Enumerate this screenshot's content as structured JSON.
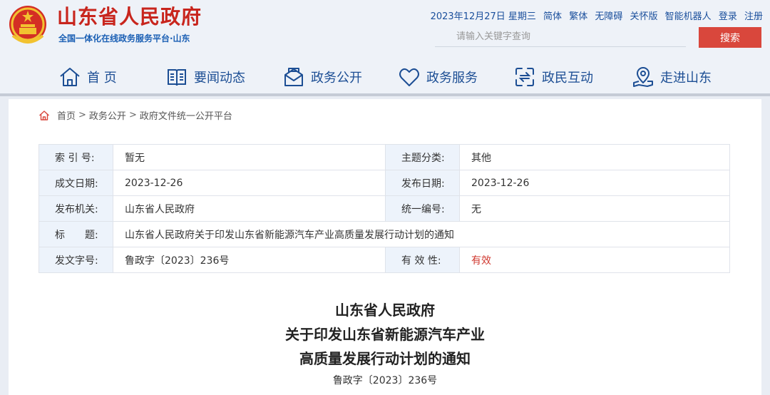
{
  "header": {
    "site_title": "山东省人民政府",
    "site_subtitle": "全国一体化在线政务服务平台·山东",
    "top_links": [
      "2023年12月27日 星期三",
      "简体",
      "繁体",
      "无障碍",
      "关怀版",
      "智能机器人",
      "登录",
      "注册"
    ],
    "search": {
      "placeholder": "请输入关键字查询",
      "button_label": "搜索"
    }
  },
  "nav": {
    "items": [
      {
        "label": "首 页",
        "icon": "home-icon"
      },
      {
        "label": "要闻动态",
        "icon": "news-icon"
      },
      {
        "label": "政务公开",
        "icon": "envelope-icon"
      },
      {
        "label": "政务服务",
        "icon": "heart-icon"
      },
      {
        "label": "政民互动",
        "icon": "interaction-icon"
      },
      {
        "label": "走进山东",
        "icon": "location-icon"
      }
    ]
  },
  "breadcrumb": {
    "home": "首页",
    "level1": "政务公开",
    "level2": "政府文件统一公开平台"
  },
  "meta_table": {
    "rows": [
      {
        "k1": "索 引 号:",
        "v1": "暂无",
        "k2": "主题分类:",
        "v2": "其他"
      },
      {
        "k1": "成文日期:",
        "v1": "2023-12-26",
        "k2": "发布日期:",
        "v2": "2023-12-26"
      },
      {
        "k1": "发布机关:",
        "v1": "山东省人民政府",
        "k2": "统一编号:",
        "v2": "无"
      },
      {
        "k1": "标　　题:",
        "v1": "山东省人民政府关于印发山东省新能源汽车产业高质量发展行动计划的通知"
      },
      {
        "k1": "发文字号:",
        "v1": "鲁政字〔2023〕236号",
        "k2": "有 效 性:",
        "v2": "有效"
      }
    ]
  },
  "document": {
    "title_lines": [
      "山东省人民政府",
      "关于印发山东省新能源汽车产业",
      "高质量发展行动计划的通知"
    ],
    "doc_number": "鲁政字〔2023〕236号"
  },
  "colors": {
    "brand_red": "#c8251d",
    "nav_blue": "#1c4e94",
    "search_button": "#d9473c",
    "valid_red": "#d0382f"
  }
}
